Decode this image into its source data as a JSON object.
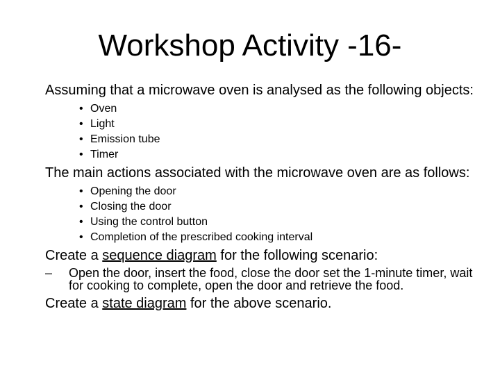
{
  "slide": {
    "title": "Workshop Activity -16-",
    "intro_objects": "Assuming that a microwave oven is analysed as the following objects:",
    "objects": [
      "Oven",
      "Light",
      "Emission tube",
      "Timer"
    ],
    "intro_actions": "The main actions associated with the microwave oven are as follows:",
    "actions": [
      "Opening the door",
      "Closing the door",
      "Using the control button",
      "Completion of the prescribed cooking interval"
    ],
    "task1": {
      "prefix": "Create a ",
      "link": "sequence diagram",
      "suffix": " for the following scenario:"
    },
    "scenario": "Open the door, insert the food, close the door set the 1-minute timer, wait for cooking to complete, open the door and retrieve the food.",
    "task2": {
      "prefix": "Create a ",
      "link": "state diagram",
      "suffix": " for the above scenario."
    },
    "bullet_glyph": "•",
    "dash_glyph": "–"
  }
}
